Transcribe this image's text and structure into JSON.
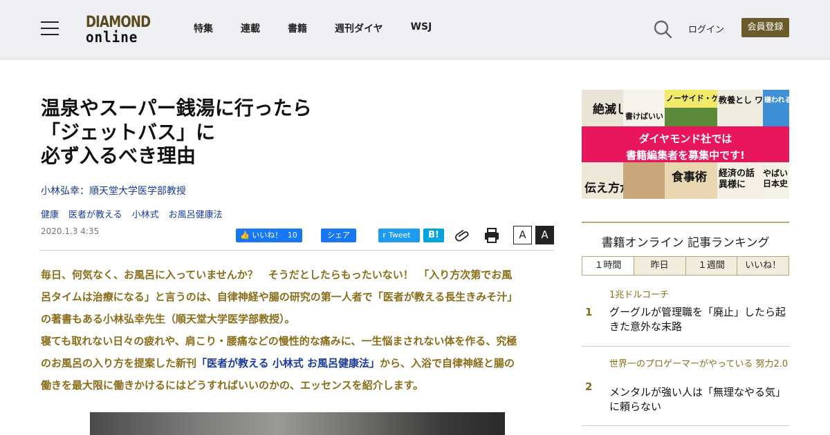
{
  "header": {
    "logo_top": "DIAMOND",
    "logo_bottom": "online",
    "nav": [
      "特集",
      "連載",
      "書籍",
      "週刊ダイヤ",
      "WSJ"
    ],
    "login": "ログイン",
    "register": "会員登録"
  },
  "article": {
    "title_lines": [
      "温泉やスーパー銭湯に行ったら",
      "「ジェットバス」に",
      "必ず入るべき理由"
    ],
    "author": "小林弘幸：順天堂大学医学部教授",
    "tags": [
      "健康",
      "医者が教える",
      "小林式",
      "お風呂健康法"
    ],
    "date": "2020.1.3 4:35",
    "share": {
      "like": "いいね！",
      "like_count": "10",
      "share": "シェア",
      "tweet": "Tweet",
      "hatena": "B!",
      "font_small": "A",
      "font_large": "A"
    },
    "lead": {
      "l1": "毎日、何気なく、お風呂に入っていませんか？　そうだとしたらもったいない！　「入り方次第でお風",
      "l2": "呂タイムは治療になる」と言うのは、自律神経や腸の研究の第一人者で「医者が教える長生きみそ汁」",
      "l3": "の著書もある小林弘幸先生（順天堂大学医学部教授）。",
      "l4": "寝ても取れない日々の疲れや、肩こり・腰痛などの慢性的な痛みに、一生悩まされない体を作る、究極",
      "l5_pre": "のお風呂の入り方を提案した新刊",
      "l5_link": "「医者が教える 小林式 お風呂健康法」",
      "l5_post": "から、入浴で自律神経と腸の",
      "l6": "働きを最大限に働きかけるにはどうすればいいのかの、エッセンスを紹介します。"
    }
  },
  "banner": {
    "line1": "ダイヤモンド社では",
    "line2": "書籍編集者を募集中です!",
    "books_top": [
      "絶滅しま",
      "書けばいい",
      "ノーサイド・ゲーム",
      "教養とし ワイ",
      "嫌われる勇気"
    ],
    "books_bottom": [
      "伝え方が",
      "",
      "食事術",
      "経済の話 異様に",
      "やばい日本史"
    ]
  },
  "ranking": {
    "title": "書籍オンライン 記事ランキング",
    "tabs": [
      "１時間",
      "昨日",
      "１週間",
      "いいね！"
    ],
    "items": [
      {
        "num": "1",
        "category": "1兆ドルコーチ",
        "headline": "グーグルが管理職を「廃止」したら起きた意外な末路"
      },
      {
        "num": "2",
        "category": "世界一のプロゲーマーがやっている 努力2.0",
        "headline": "メンタルが強い人は「無理なやる気」に頼らない"
      }
    ]
  },
  "colors": {
    "accent_gold": "#8a6d1a",
    "link_blue": "#1a3a9c",
    "register_bg": "#6b5a2a",
    "facebook": "#1877f2",
    "twitter": "#1d9bf0",
    "hatena": "#00a4de",
    "banner_pink": "#e8175d"
  }
}
